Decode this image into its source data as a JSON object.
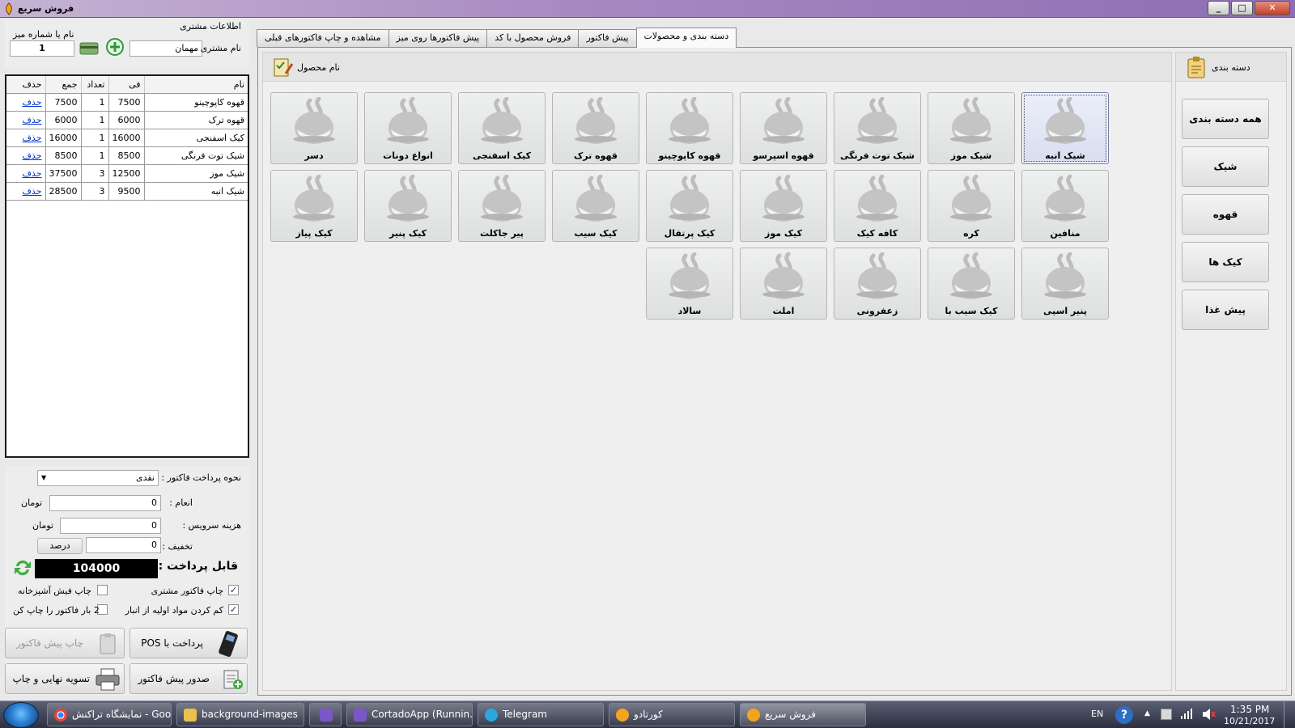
{
  "window": {
    "title": "فروش سریع",
    "controls": [
      "_",
      "□",
      "✕"
    ]
  },
  "customer": {
    "section_title": "اطلاعات مشتری",
    "table_label": "نام یا شماره میز",
    "table_value": "1",
    "name_label": "نام مشتری",
    "name_value": "مهمان"
  },
  "order": {
    "headers": {
      "name": "نام",
      "price": "فی",
      "qty": "تعداد",
      "total": "جمع",
      "delete": "حذف"
    },
    "rows": [
      {
        "name": "قهوه کاپوچینو",
        "price": "7500",
        "qty": "1",
        "total": "7500",
        "delete": "حذف"
      },
      {
        "name": "قهوه ترک",
        "price": "6000",
        "qty": "1",
        "total": "6000",
        "delete": "حذف"
      },
      {
        "name": "کیک اسفنجی",
        "price": "16000",
        "qty": "1",
        "total": "16000",
        "delete": "حذف"
      },
      {
        "name": "شیک توت فرنگی",
        "price": "8500",
        "qty": "1",
        "total": "8500",
        "delete": "حذف"
      },
      {
        "name": "شیک موز",
        "price": "12500",
        "qty": "3",
        "total": "37500",
        "delete": "حذف"
      },
      {
        "name": "شیک انبه",
        "price": "9500",
        "qty": "3",
        "total": "28500",
        "delete": "حذف"
      }
    ]
  },
  "payment": {
    "method_label": "نحوه پرداخت فاکتور :",
    "method_value": "نقدی",
    "tip_label": "انعام :",
    "tip_value": "0",
    "tip_unit": "تومان",
    "service_label": "هزینه سرویس :",
    "service_value": "0",
    "service_unit": "تومان",
    "discount_label": "تخفیف :",
    "discount_value": "0",
    "discount_button": "درصد",
    "payable_label": "قابل پرداخت :",
    "payable_value": "104000",
    "check_customer": "چاپ فاکتور مشتری",
    "check_kitchen": "چاپ فیش آشپزخانه",
    "check_inventory": "کم کردن مواد اولیه از انبار",
    "check_print_twice": "2 بار فاکتور را چاپ کن",
    "btn_pos": "پرداخت با POS",
    "btn_print_pre": "چاپ پیش فاکتور",
    "btn_issue_pre": "صدور پیش فاکتور",
    "btn_settle_print": "تسویه نهایی و چاپ"
  },
  "tabs": [
    "دسته بندی و محصولات",
    "پیش فاکتور",
    "فروش محصول با کد",
    "پیش فاکتورها روی میز",
    "مشاهده و چاپ فاکتورهای قبلی"
  ],
  "products_header": "نام محصول",
  "products": [
    "شیک انبه",
    "شیک موز",
    "شیک توت فرنگی",
    "قهوه اسپرسو",
    "قهوه کاپوچینو",
    "قهوه ترک",
    "کیک اسفنجی",
    "انواع دونات",
    "دسر",
    "منافین",
    "کره",
    "کافه کیک",
    "کیک موز",
    "کیک پرتقال",
    "کیک سیب",
    "پیر جاکلت",
    "کیک پنیر",
    "کیک پیاز",
    "پنیر اسپی",
    "کیک سیب با",
    "زعفرونی",
    "املت",
    "سالاد"
  ],
  "categories_header": "دسته بندی",
  "categories": [
    "همه دسته بندی ها",
    "شیک",
    "قهوه",
    "کیک ها",
    "پیش غذا"
  ],
  "taskbar": {
    "items": [
      "نمایشگاه تراکنش - Goo...",
      "background-images",
      "",
      "CortadoApp (Runnin...",
      "Telegram",
      "کورتادو",
      "فروش سریع"
    ],
    "lang": "EN",
    "time": "1:35 PM",
    "date": "10/21/2017"
  }
}
